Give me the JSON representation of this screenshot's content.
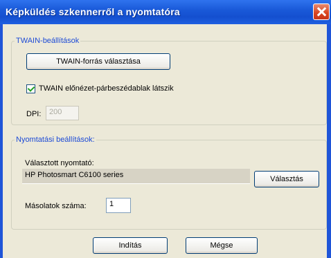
{
  "window": {
    "title": "Képküldés szkennerről a nyomtatóra",
    "close_icon": "close-icon"
  },
  "twain": {
    "group_title": "TWAIN-beállítások",
    "select_source_button": "TWAIN-forrás választása",
    "preview_checkbox_label": "TWAIN előnézet-párbeszédablak látszik",
    "preview_checked": true,
    "dpi_label": "DPI:",
    "dpi_value": "200"
  },
  "print": {
    "group_title": "Nyomtatási beállítások:",
    "selected_printer_label": "Választott nyomtató:",
    "selected_printer_value": "HP Photosmart C6100 series",
    "choose_button": "Választás",
    "copies_label": "Másolatok száma:",
    "copies_value": "1"
  },
  "footer": {
    "start_button": "Indítás",
    "cancel_button": "Mégse"
  },
  "colors": {
    "titlebar": "#1a5ad9",
    "group_title": "#1c4ad6",
    "dialog_bg": "#ece9d8"
  }
}
